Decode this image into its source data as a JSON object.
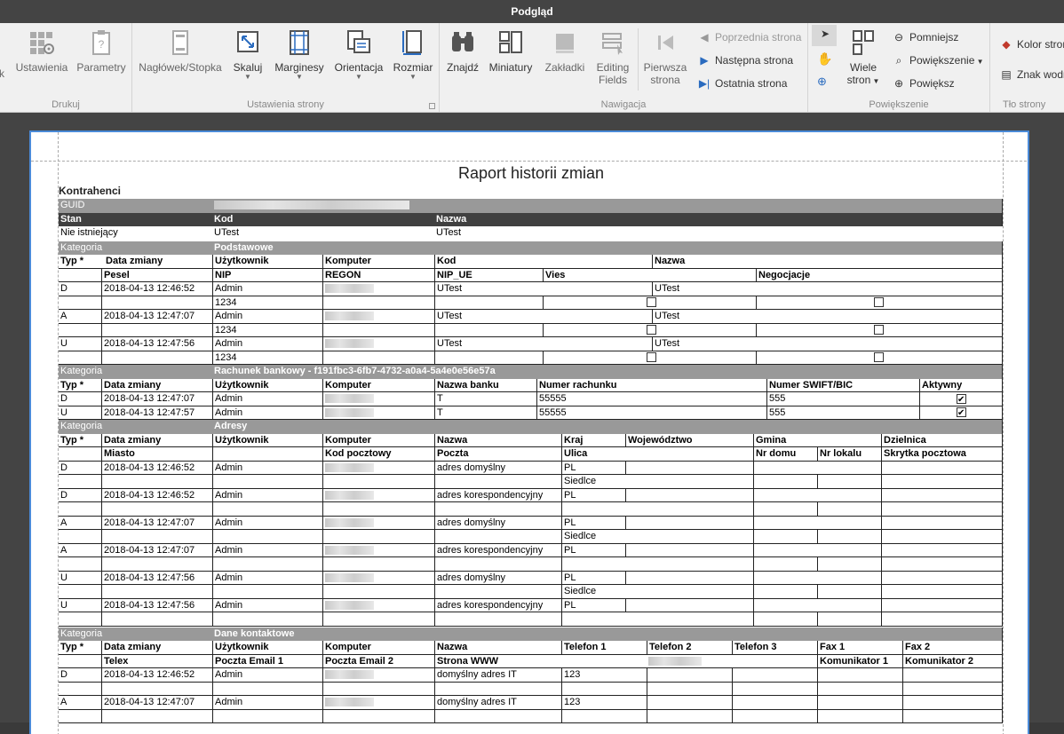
{
  "window": {
    "title": "Podgląd"
  },
  "ribbon": {
    "drukuj": {
      "label": "Drukuj",
      "k": "k",
      "ustawienia": "Ustawienia",
      "parametry": "Parametry"
    },
    "ustawienia_strony": {
      "label": "Ustawienia strony",
      "naglowek": "Nagłówek/Stopka",
      "skaluj": "Skaluj",
      "marginesy": "Marginesy",
      "orientacja": "Orientacja",
      "rozmiar": "Rozmiar"
    },
    "nawigacja": {
      "label": "Nawigacja",
      "znajdz": "Znajdź",
      "miniatury": "Miniatury",
      "zakladki": "Zakładki",
      "editing": "Editing",
      "fields": "Fields",
      "pierwsza": "Pierwsza",
      "strona": "strona",
      "poprzednia": "Poprzednia strona",
      "nastepna": "Następna strona",
      "ostatnia": "Ostatnia strona"
    },
    "powiekszenie": {
      "label": "Powiększenie",
      "wiele": "Wiele",
      "stron": "stron",
      "pomniejsz": "Pomniejsz",
      "powiekszenie": "Powiększenie",
      "powieksz": "Powiększ"
    },
    "tlo": {
      "label": "Tło strony",
      "kolor": "Kolor stron",
      "znak": "Znak wodn"
    }
  },
  "report": {
    "title": "Raport historii zmian",
    "subtitle": "Kontrahenci",
    "guid_label": "GUID",
    "stan": "Stan",
    "kod": "Kod",
    "nazwa": "Nazwa",
    "stan_val": "Nie istniejący",
    "kod_val": "UTest",
    "nazwa_val": "UTest",
    "kategoria": "Kategoria",
    "cat1": "Podstawowe",
    "cat2": "Rachunek bankowy - f191fbc3-6fb7-4732-a0a4-5a4e0e56e57a",
    "cat3": "Adresy",
    "cat4": "Dane kontaktowe",
    "h": {
      "typ": "Typ *",
      "data": "Data zmiany",
      "uzytkownik": "Użytkownik",
      "komputer": "Komputer",
      "kod": "Kod",
      "nazwa": "Nazwa",
      "pesel": "Pesel",
      "nip": "NIP",
      "regon": "REGON",
      "nip_ue": "NIP_UE",
      "vies": "Vies",
      "negocjacje": "Negocjacje",
      "nazwa_banku": "Nazwa banku",
      "numer_rach": "Numer rachunku",
      "swift": "Numer SWIFT/BIC",
      "aktywny": "Aktywny",
      "kraj": "Kraj",
      "woj": "Województwo",
      "gmina": "Gmina",
      "dzielnica": "Dzielnica",
      "miasto": "Miasto",
      "kod_pocztowy": "Kod pocztowy",
      "poczta": "Poczta",
      "ulica": "Ulica",
      "nr_domu": "Nr domu",
      "nr_lokalu": "Nr lokalu",
      "skrytka": "Skrytka pocztowa",
      "tel1": "Telefon 1",
      "tel2": "Telefon 2",
      "tel3": "Telefon 3",
      "fax1": "Fax 1",
      "fax2": "Fax 2",
      "telex": "Telex",
      "email1": "Poczta Email 1",
      "email2": "Poczta Email 2",
      "www": "Strona WWW",
      "kom1": "Komunikator 1",
      "kom2": "Komunikator 2"
    },
    "podst": [
      {
        "typ": "D",
        "data": "2018-04-13 12:46:52",
        "user": "Admin",
        "kod": "UTest",
        "nazwa": "UTest",
        "nip": "1234"
      },
      {
        "typ": "A",
        "data": "2018-04-13 12:47:07",
        "user": "Admin",
        "kod": "UTest",
        "nazwa": "UTest",
        "nip": "1234"
      },
      {
        "typ": "U",
        "data": "2018-04-13 12:47:56",
        "user": "Admin",
        "kod": "UTest",
        "nazwa": "UTest",
        "nip": "1234"
      }
    ],
    "bank": [
      {
        "typ": "D",
        "data": "2018-04-13 12:47:07",
        "user": "Admin",
        "nazwa_banku": "T",
        "numer": "55555",
        "swift": "555"
      },
      {
        "typ": "U",
        "data": "2018-04-13 12:47:57",
        "user": "Admin",
        "nazwa_banku": "T",
        "numer": "55555",
        "swift": "555"
      }
    ],
    "adresy": [
      {
        "typ": "D",
        "data": "2018-04-13 12:46:52",
        "user": "Admin",
        "nazwa": "adres domyślny",
        "kraj": "PL",
        "ulica": "Siedlce"
      },
      {
        "typ": "D",
        "data": "2018-04-13 12:46:52",
        "user": "Admin",
        "nazwa": "adres korespondencyjny",
        "kraj": "PL",
        "ulica": ""
      },
      {
        "typ": "A",
        "data": "2018-04-13 12:47:07",
        "user": "Admin",
        "nazwa": "adres domyślny",
        "kraj": "PL",
        "ulica": "Siedlce"
      },
      {
        "typ": "A",
        "data": "2018-04-13 12:47:07",
        "user": "Admin",
        "nazwa": "adres korespondencyjny",
        "kraj": "PL",
        "ulica": ""
      },
      {
        "typ": "U",
        "data": "2018-04-13 12:47:56",
        "user": "Admin",
        "nazwa": "adres domyślny",
        "kraj": "PL",
        "ulica": "Siedlce"
      },
      {
        "typ": "U",
        "data": "2018-04-13 12:47:56",
        "user": "Admin",
        "nazwa": "adres korespondencyjny",
        "kraj": "PL",
        "ulica": ""
      }
    ],
    "kontakt": [
      {
        "typ": "D",
        "data": "2018-04-13 12:46:52",
        "user": "Admin",
        "nazwa": "domyślny adres IT",
        "tel1": "123"
      },
      {
        "typ": "A",
        "data": "2018-04-13 12:47:07",
        "user": "Admin",
        "nazwa": "domyślny adres IT",
        "tel1": "123"
      }
    ]
  }
}
